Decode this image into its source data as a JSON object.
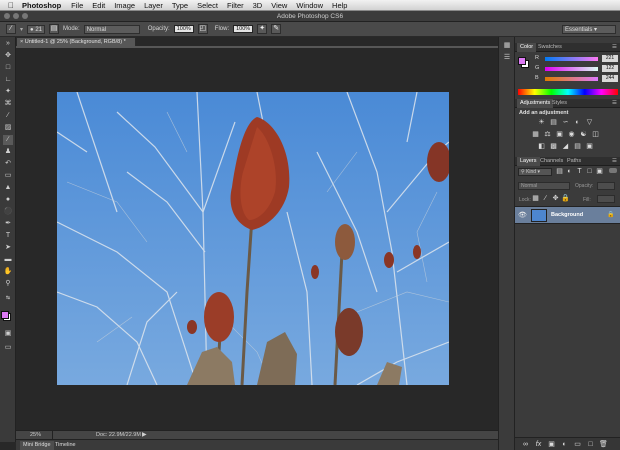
{
  "menubar": {
    "apple": "",
    "app": "Photoshop",
    "items": [
      "File",
      "Edit",
      "Image",
      "Layer",
      "Type",
      "Select",
      "Filter",
      "3D",
      "View",
      "Window",
      "Help"
    ]
  },
  "titlebar": {
    "title": "Adobe Photoshop CS6"
  },
  "options": {
    "brush_size": "21",
    "mode_label": "Mode:",
    "mode_value": "Normal",
    "opacity_label": "Opacity:",
    "opacity_value": "100%",
    "flow_label": "Flow:",
    "flow_value": "100%",
    "workspace": "Essentials"
  },
  "document": {
    "tab_title": "Untitled-1 @ 25% (Background, RGB/8) *"
  },
  "status": {
    "zoom": "25%",
    "doc_size": "Doc: 22.9M/22.9M"
  },
  "bottom_tabs": [
    "Mini Bridge",
    "Timeline"
  ],
  "color_panel": {
    "tabs": [
      "Color",
      "Swatches"
    ],
    "channels": [
      {
        "label": "R",
        "value": "221"
      },
      {
        "label": "G",
        "value": "122"
      },
      {
        "label": "B",
        "value": "244"
      }
    ],
    "foreground_color": "#dd7af4",
    "background_color": "#ffffff"
  },
  "adjustments_panel": {
    "tabs": [
      "Adjustments",
      "Styles"
    ],
    "heading": "Add an adjustment"
  },
  "layers_panel": {
    "tabs": [
      "Layers",
      "Channels",
      "Paths"
    ],
    "kind_filter": "Kind",
    "blend_mode": "Normal",
    "opacity_label": "Opacity:",
    "lock_label": "Lock:",
    "fill_label": "Fill:",
    "layers": [
      {
        "name": "Background",
        "visible": true,
        "locked": true
      }
    ]
  },
  "colors": {
    "ui_dark": "#282828",
    "panel": "#3b3b3b",
    "sky": "#5d95d6",
    "sumac": "#9e3a24"
  }
}
